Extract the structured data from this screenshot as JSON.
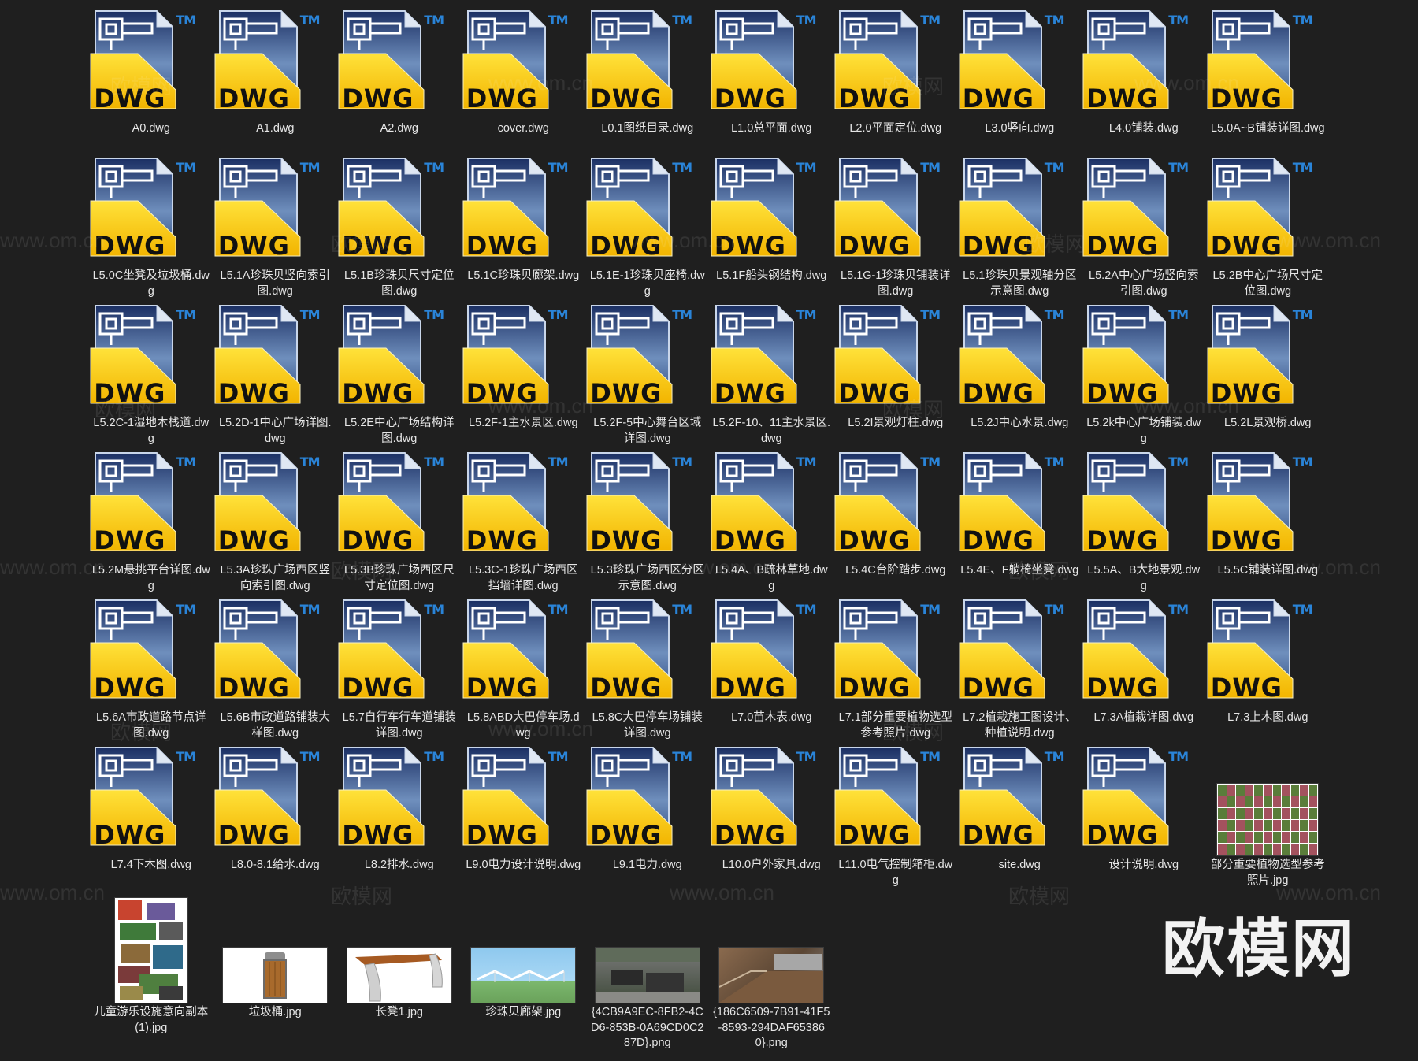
{
  "icon_badge": "TM",
  "icon_type_text": "DWG",
  "files": [
    "A0.dwg",
    "A1.dwg",
    "A2.dwg",
    "cover.dwg",
    "L0.1图纸目录.dwg",
    "L1.0总平面.dwg",
    "L2.0平面定位.dwg",
    "L3.0竖向.dwg",
    "L4.0铺装.dwg",
    "L5.0A~B铺装详图.dwg",
    "L5.0C坐凳及垃圾桶.dwg",
    "L5.1A珍珠贝竖向索引图.dwg",
    "L5.1B珍珠贝尺寸定位图.dwg",
    "L5.1C珍珠贝廊架.dwg",
    "L5.1E-1珍珠贝座椅.dwg",
    "L5.1F船头钢结构.dwg",
    "L5.1G-1珍珠贝铺装详图.dwg",
    "L5.1珍珠贝景观轴分区示意图.dwg",
    "L5.2A中心广场竖向索引图.dwg",
    "L5.2B中心广场尺寸定位图.dwg",
    "L5.2C-1湿地木栈道.dwg",
    "L5.2D-1中心广场详图.dwg",
    "L5.2E中心广场结构详图.dwg",
    "L5.2F-1主水景区.dwg",
    "L5.2F-5中心舞台区域详图.dwg",
    "L5.2F-10、11主水景区.dwg",
    "L5.2I景观灯柱.dwg",
    "L5.2J中心水景.dwg",
    "L5.2k中心广场铺装.dwg",
    "L5.2L景观桥.dwg",
    "L5.2M悬挑平台详图.dwg",
    "L5.3A珍珠广场西区竖向索引图.dwg",
    "L5.3B珍珠广场西区尺寸定位图.dwg",
    "L5.3C-1珍珠广场西区挡墙详图.dwg",
    "L5.3珍珠广场西区分区示意图.dwg",
    "L5.4A、B疏林草地.dwg",
    "L5.4C台阶踏步.dwg",
    "L5.4E、F躺椅坐凳.dwg",
    "L5.5A、B大地景观.dwg",
    "L5.5C铺装详图.dwg",
    "L5.6A市政道路节点详图.dwg",
    "L5.6B市政道路铺装大样图.dwg",
    "L5.7自行车行车道铺装详图.dwg",
    "L5.8ABD大巴停车场.dwg",
    "L5.8C大巴停车场铺装详图.dwg",
    "L7.0苗木表.dwg",
    "L7.1部分重要植物选型参考照片.dwg",
    "L7.2植栽施工图设计、种植说明.dwg",
    "L7.3A植栽详图.dwg",
    "L7.3上木图.dwg",
    "L7.4下木图.dwg",
    "L8.0-8.1给水.dwg",
    "L8.2排水.dwg",
    "L9.0电力设计说明.dwg",
    "L9.1电力.dwg",
    "L10.0户外家具.dwg",
    "L11.0电气控制箱柜.dwg",
    "site.dwg",
    "设计说明.dwg"
  ],
  "images": [
    {
      "name": "部分重要植物选型参考照片.jpg",
      "kind": "mosaic"
    },
    {
      "name": "儿童游乐设施意向副本(1).jpg",
      "kind": "collage"
    },
    {
      "name": "垃圾桶.jpg",
      "kind": "bin"
    },
    {
      "name": "长凳1.jpg",
      "kind": "bench"
    },
    {
      "name": "珍珠贝廊架.jpg",
      "kind": "canopy"
    },
    {
      "name": "{4CB9A9EC-8FB2-4CD6-853B-0A69CD0C287D}.png",
      "kind": "dark1"
    },
    {
      "name": "{186C6509-7B91-41F5-8593-294DAF653860}.png",
      "kind": "dark2"
    }
  ],
  "watermark": "欧模网",
  "watermark_url": "www.om.cn",
  "logo": "欧模网"
}
